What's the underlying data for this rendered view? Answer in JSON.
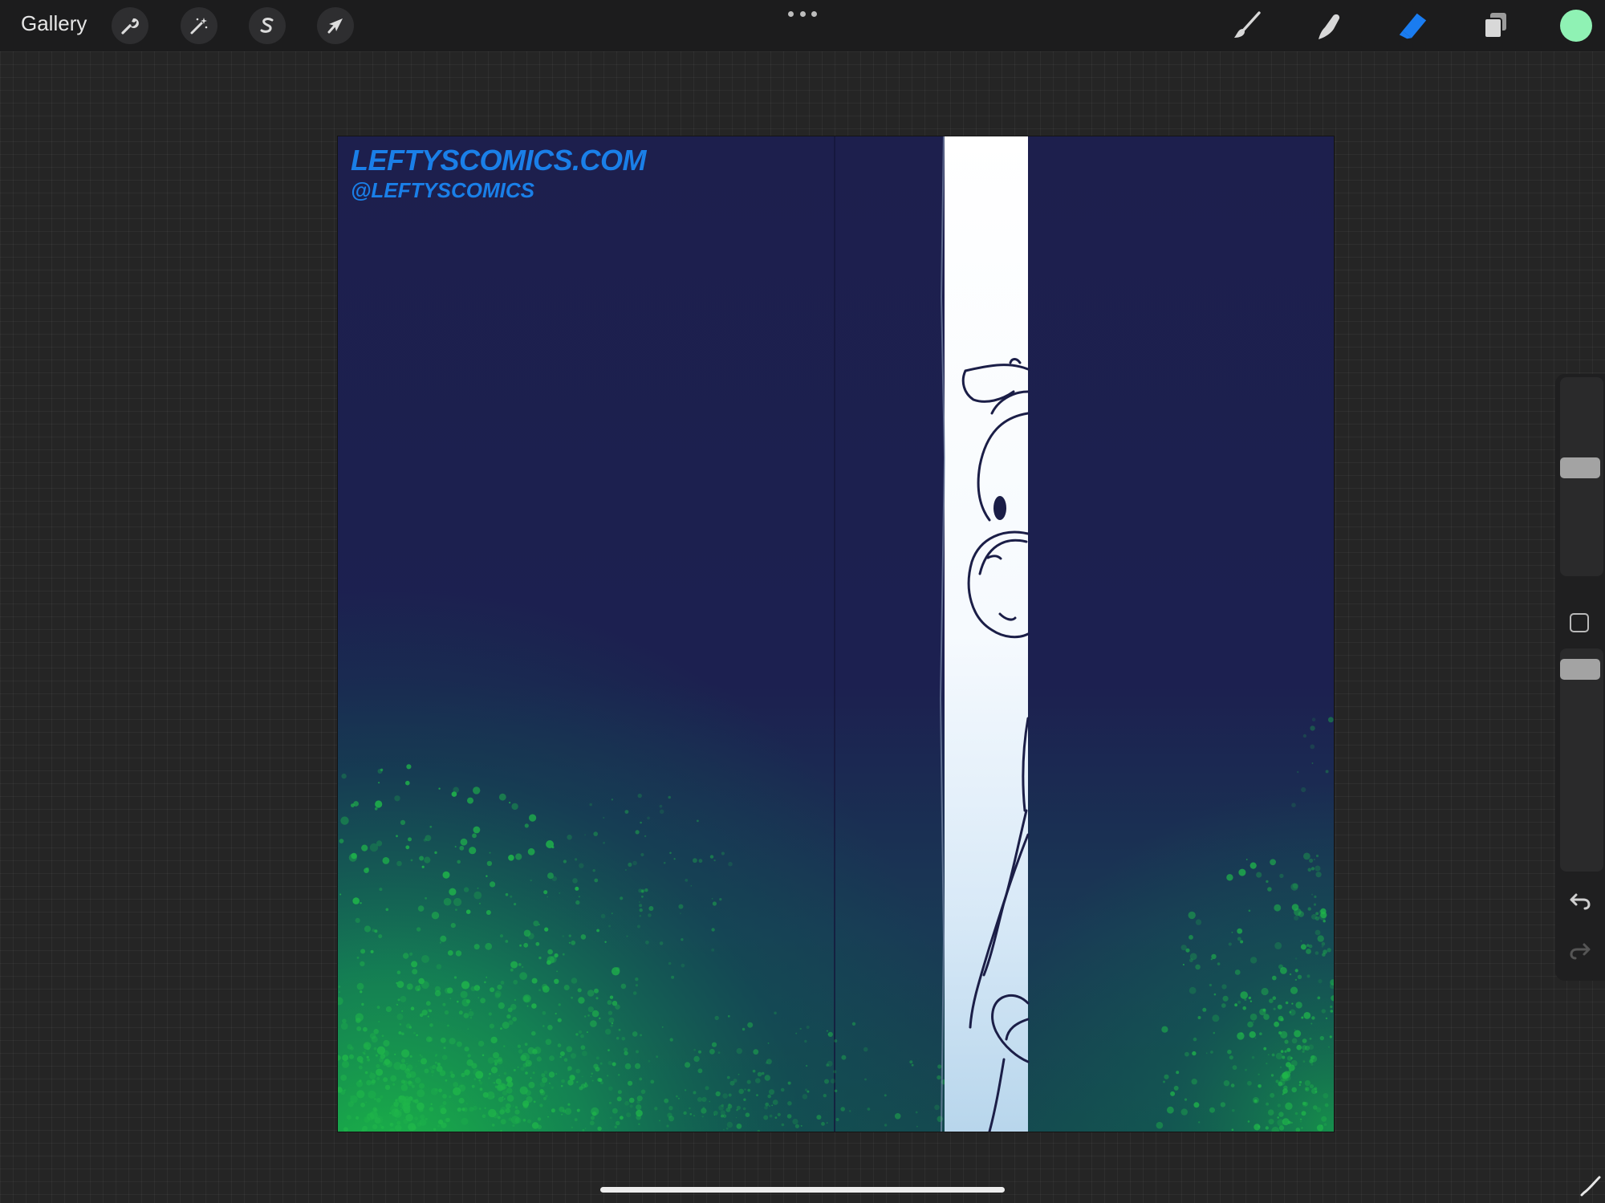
{
  "app": {
    "gallery_label": "Gallery"
  },
  "toolbar_left": [
    {
      "name": "actions",
      "icon": "wrench-icon"
    },
    {
      "name": "adjustments",
      "icon": "magic-wand-icon"
    },
    {
      "name": "selection",
      "icon": "selection-s-icon"
    },
    {
      "name": "transform",
      "icon": "arrow-cursor-icon"
    }
  ],
  "toolbar_right": [
    {
      "name": "brush",
      "icon": "paintbrush-icon",
      "active": false
    },
    {
      "name": "smudge",
      "icon": "smudge-finger-icon",
      "active": false
    },
    {
      "name": "eraser",
      "icon": "eraser-icon",
      "active": true
    },
    {
      "name": "layers",
      "icon": "layers-icon",
      "active": false
    }
  ],
  "colors": {
    "current_color": "#8ff2b4",
    "active_tool": "#1a7cf0",
    "canvas_bg": "#1d1f4d",
    "spray_green": "#1fb54a"
  },
  "canvas": {
    "watermark_line1": "LEFTYSCOMICS.COM",
    "watermark_line2": "@LEFTYSCOMICS"
  },
  "sidebar": {
    "brush_size_level": 0.55,
    "opacity_level": 0.95,
    "modify_icon": "square-icon",
    "undo_icon": "undo-icon",
    "redo_icon": "redo-icon"
  }
}
